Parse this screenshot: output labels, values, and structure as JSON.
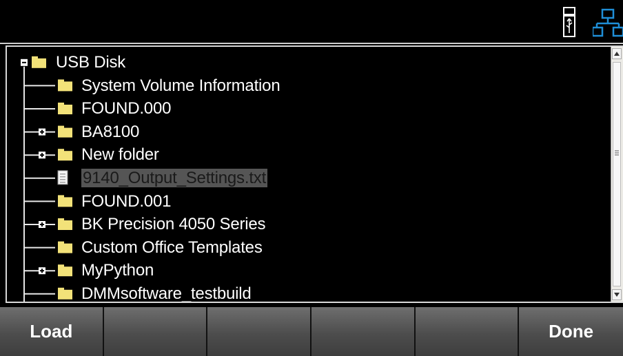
{
  "statusbar": {
    "usb_icon": "usb-drive-icon",
    "network_icon": "network-icon"
  },
  "tree": {
    "root": {
      "label": "USB Disk",
      "expanded": true
    },
    "items": [
      {
        "label": "System Volume Information",
        "type": "folder",
        "expandable": false
      },
      {
        "label": "FOUND.000",
        "type": "folder",
        "expandable": false
      },
      {
        "label": "BA8100",
        "type": "folder",
        "expandable": true
      },
      {
        "label": "New folder",
        "type": "folder",
        "expandable": true
      },
      {
        "label": "9140_Output_Settings.txt",
        "type": "file",
        "expandable": false,
        "selected": true
      },
      {
        "label": "FOUND.001",
        "type": "folder",
        "expandable": false
      },
      {
        "label": "BK Precision 4050 Series",
        "type": "folder",
        "expandable": true
      },
      {
        "label": "Custom Office Templates",
        "type": "folder",
        "expandable": false
      },
      {
        "label": "MyPython",
        "type": "folder",
        "expandable": true
      },
      {
        "label": "DMMsoftware_testbuild",
        "type": "folder",
        "expandable": false
      }
    ]
  },
  "softkeys": [
    "Load",
    "",
    "",
    "",
    "",
    "Done"
  ],
  "colors": {
    "folder": "#f2e279",
    "selection": "#555555",
    "softkey": "#5a5a5a"
  }
}
